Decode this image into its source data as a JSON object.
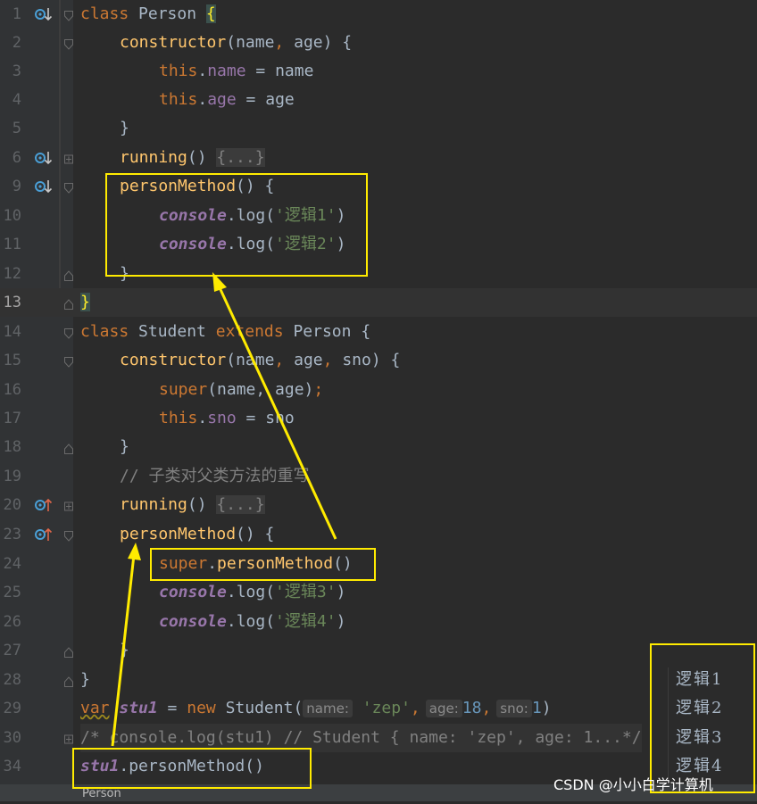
{
  "editor": {
    "status": {
      "breadcrumb": "Person"
    },
    "console_output": [
      "逻辑1",
      "逻辑2",
      "逻辑3",
      "逻辑4"
    ],
    "watermark": "CSDN @小小白学计算机",
    "lines": {
      "l1": {
        "num": "1",
        "kw": "class",
        "name": "Person",
        "brace": "{"
      },
      "l2": {
        "num": "2",
        "fn": "constructor",
        "open": "(",
        "p1": "name",
        "sep": ", ",
        "p2": "age",
        "close": ") {"
      },
      "l3": {
        "num": "3",
        "kw": "this",
        "dot": ".",
        "prop": "name",
        "rest": " = name"
      },
      "l4": {
        "num": "4",
        "kw": "this",
        "dot": ".",
        "prop": "age",
        "rest": " = age"
      },
      "l5": {
        "num": "5",
        "text": "}"
      },
      "l6": {
        "num": "6",
        "fn": "running",
        "paren": "() ",
        "folded": "{...}"
      },
      "l9": {
        "num": "9",
        "fn": "personMethod",
        "rest": "() {"
      },
      "l10": {
        "num": "10",
        "obj": "console",
        "call": ".log(",
        "str": "'逻辑1'",
        "close": ")"
      },
      "l11": {
        "num": "11",
        "obj": "console",
        "call": ".log(",
        "str": "'逻辑2'",
        "close": ")"
      },
      "l12": {
        "num": "12",
        "text": "}"
      },
      "l13": {
        "num": "13",
        "text": "}"
      },
      "l14": {
        "num": "14",
        "kw": "class",
        "name": "Student",
        "kw2": "extends",
        "name2": "Person",
        "brace": "{"
      },
      "l15": {
        "num": "15",
        "fn": "constructor",
        "open": "(",
        "p1": "name",
        "sep1": ", ",
        "p2": "age",
        "sep2": ", ",
        "p3": "sno",
        "close": ") {"
      },
      "l16": {
        "num": "16",
        "fn": "super",
        "args": "(name, age)",
        "semi": ";"
      },
      "l17": {
        "num": "17",
        "kw": "this",
        "dot": ".",
        "prop": "sno",
        "rest": " = sno"
      },
      "l18": {
        "num": "18",
        "text": "}"
      },
      "l19": {
        "num": "19",
        "comment": "// 子类对父类方法的重写"
      },
      "l20": {
        "num": "20",
        "fn": "running",
        "paren": "() ",
        "folded": "{...}"
      },
      "l23": {
        "num": "23",
        "fn": "personMethod",
        "rest": "() {"
      },
      "l24": {
        "num": "24",
        "kw": "super",
        "dot": ".",
        "fn": "personMethod",
        "rest": "()"
      },
      "l25": {
        "num": "25",
        "obj": "console",
        "call": ".log(",
        "str": "'逻辑3'",
        "close": ")"
      },
      "l26": {
        "num": "26",
        "obj": "console",
        "call": ".log(",
        "str": "'逻辑4'",
        "close": ")"
      },
      "l27": {
        "num": "27",
        "text": "}"
      },
      "l28": {
        "num": "28",
        "text": "}"
      },
      "l29": {
        "num": "29",
        "kw": "var",
        "var": "stu1",
        "eq": " = ",
        "kw2": "new",
        "cls": " Student(",
        "h1": "name:",
        "v1": "'zep'",
        "c1": ",",
        "h2": "age:",
        "v2": "18",
        "c2": ",",
        "h3": "sno:",
        "v3": "1",
        "close": ")"
      },
      "l30": {
        "num": "30",
        "comment": "/* console.log(stu1) // Student { name: 'zep', age: 1...*/"
      },
      "l34": {
        "num": "34",
        "var": "stu1",
        "rest": ".personMethod()"
      }
    }
  },
  "colors": {
    "highlight_box": "#ffeb00",
    "background": "#2b2b2b",
    "gutter": "#313335"
  }
}
